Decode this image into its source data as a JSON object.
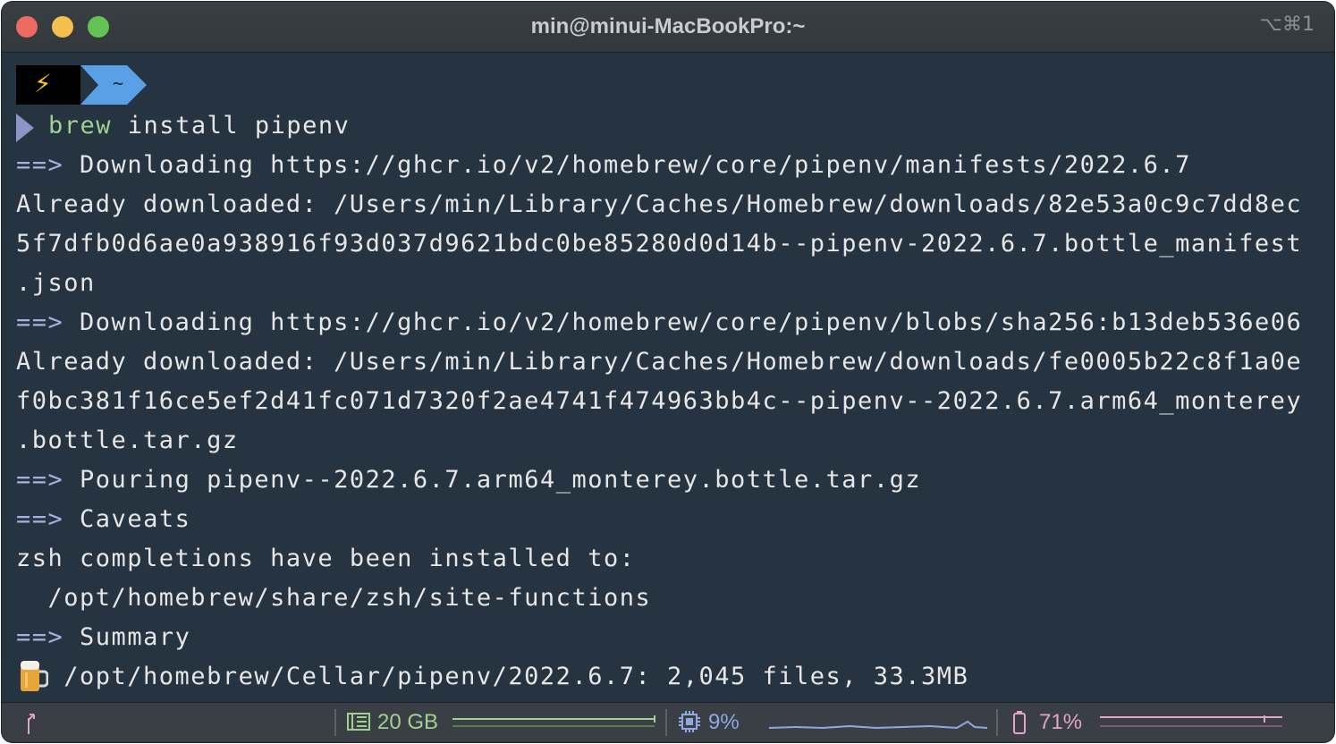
{
  "window": {
    "title": "min@minui-MacBookPro:~",
    "shortcut": "⌥⌘1"
  },
  "prompt": {
    "dir": "~",
    "icon_bolt": "lightning-icon"
  },
  "command": {
    "program": "brew",
    "args": "install pipenv"
  },
  "output": [
    {
      "prefix": "==>",
      "text": "Downloading https://ghcr.io/v2/homebrew/core/pipenv/manifests/2022.6.7"
    },
    {
      "prefix": "",
      "text": "Already downloaded: /Users/min/Library/Caches/Homebrew/downloads/82e53a0c9c7dd8ec"
    },
    {
      "prefix": "",
      "text": "5f7dfb0d6ae0a938916f93d037d9621bdc0be85280d0d14b--pipenv-2022.6.7.bottle_manifest"
    },
    {
      "prefix": "",
      "text": ".json"
    },
    {
      "prefix": "==>",
      "text": "Downloading https://ghcr.io/v2/homebrew/core/pipenv/blobs/sha256:b13deb536e06"
    },
    {
      "prefix": "",
      "text": "Already downloaded: /Users/min/Library/Caches/Homebrew/downloads/fe0005b22c8f1a0e"
    },
    {
      "prefix": "",
      "text": "f0bc381f16ce5ef2d41fc071d7320f2ae4741f474963bb4c--pipenv--2022.6.7.arm64_monterey"
    },
    {
      "prefix": "",
      "text": ".bottle.tar.gz"
    },
    {
      "prefix": "==>",
      "text": "Pouring pipenv--2022.6.7.arm64_monterey.bottle.tar.gz"
    },
    {
      "prefix": "==>",
      "text": "Caveats"
    },
    {
      "prefix": "",
      "text": "zsh completions have been installed to:"
    },
    {
      "prefix": "",
      "text": "  /opt/homebrew/share/zsh/site-functions"
    },
    {
      "prefix": "==>",
      "text": "Summary"
    },
    {
      "prefix": "",
      "text": "   /opt/homebrew/Cellar/pipenv/2022.6.7: 2,045 files, 33.3MB"
    }
  ],
  "status": {
    "disk": {
      "label": "20 GB",
      "color": "#9fd18f",
      "icon": "disk-icon"
    },
    "cpu": {
      "label": "9%",
      "color": "#8fa8e0",
      "icon": "cpu-icon"
    },
    "battery": {
      "label": "71%",
      "color": "#e0a3c6",
      "icon": "battery-icon"
    }
  }
}
